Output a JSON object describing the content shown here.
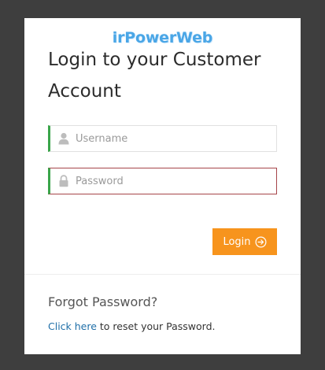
{
  "brand": {
    "logo_text": "irPowerWeb"
  },
  "login": {
    "title": "Login to your Customer Account",
    "username": {
      "placeholder": "Username",
      "value": "",
      "icon": "user-icon"
    },
    "password": {
      "placeholder": "Password",
      "value": "",
      "icon": "lock-icon"
    },
    "button_label": "Login",
    "button_icon": "arrow-circle-right-icon",
    "button_color": "#f7941d"
  },
  "forgot": {
    "heading": "Forgot Password?",
    "link_text": "Click here",
    "trailing_text": " to reset your Password."
  },
  "colors": {
    "background": "#3e3e3e",
    "card": "#ffffff",
    "valid_border": "#3aa54a",
    "error_border": "#a6454a",
    "link": "#1f6fa8"
  }
}
